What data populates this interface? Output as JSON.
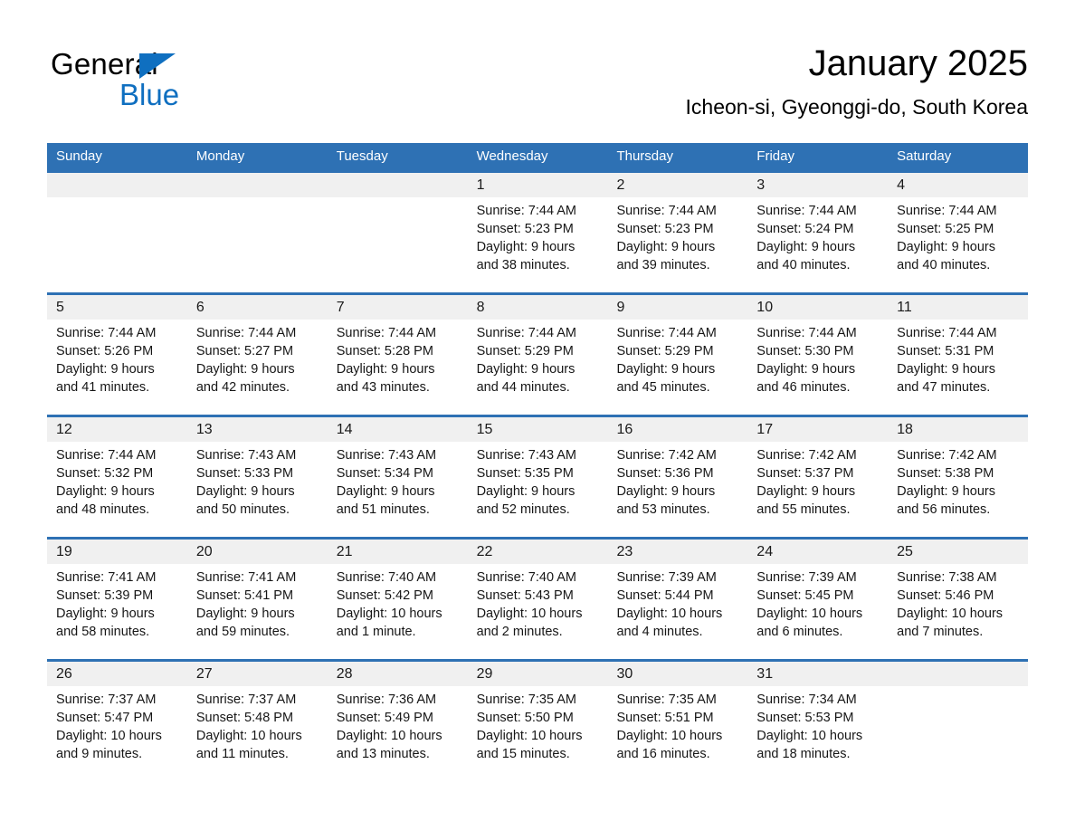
{
  "brand": {
    "name_part1": "General",
    "name_part2": "Blue",
    "triangle_icon": "triangle-icon",
    "accent_color": "#0F6FC0"
  },
  "header": {
    "title": "January 2025",
    "subtitle": "Icheon-si, Gyeonggi-do, South Korea"
  },
  "theme": {
    "header_blue": "#2E71B4",
    "daynum_band_gray": "#F0F0F0",
    "text_black": "#000000"
  },
  "weekdays": [
    "Sunday",
    "Monday",
    "Tuesday",
    "Wednesday",
    "Thursday",
    "Friday",
    "Saturday"
  ],
  "weeks": [
    [
      {
        "day": "",
        "sunrise": "",
        "sunset": "",
        "daylight1": "",
        "daylight2": ""
      },
      {
        "day": "",
        "sunrise": "",
        "sunset": "",
        "daylight1": "",
        "daylight2": ""
      },
      {
        "day": "",
        "sunrise": "",
        "sunset": "",
        "daylight1": "",
        "daylight2": ""
      },
      {
        "day": "1",
        "sunrise": "Sunrise: 7:44 AM",
        "sunset": "Sunset: 5:23 PM",
        "daylight1": "Daylight: 9 hours",
        "daylight2": "and 38 minutes."
      },
      {
        "day": "2",
        "sunrise": "Sunrise: 7:44 AM",
        "sunset": "Sunset: 5:23 PM",
        "daylight1": "Daylight: 9 hours",
        "daylight2": "and 39 minutes."
      },
      {
        "day": "3",
        "sunrise": "Sunrise: 7:44 AM",
        "sunset": "Sunset: 5:24 PM",
        "daylight1": "Daylight: 9 hours",
        "daylight2": "and 40 minutes."
      },
      {
        "day": "4",
        "sunrise": "Sunrise: 7:44 AM",
        "sunset": "Sunset: 5:25 PM",
        "daylight1": "Daylight: 9 hours",
        "daylight2": "and 40 minutes."
      }
    ],
    [
      {
        "day": "5",
        "sunrise": "Sunrise: 7:44 AM",
        "sunset": "Sunset: 5:26 PM",
        "daylight1": "Daylight: 9 hours",
        "daylight2": "and 41 minutes."
      },
      {
        "day": "6",
        "sunrise": "Sunrise: 7:44 AM",
        "sunset": "Sunset: 5:27 PM",
        "daylight1": "Daylight: 9 hours",
        "daylight2": "and 42 minutes."
      },
      {
        "day": "7",
        "sunrise": "Sunrise: 7:44 AM",
        "sunset": "Sunset: 5:28 PM",
        "daylight1": "Daylight: 9 hours",
        "daylight2": "and 43 minutes."
      },
      {
        "day": "8",
        "sunrise": "Sunrise: 7:44 AM",
        "sunset": "Sunset: 5:29 PM",
        "daylight1": "Daylight: 9 hours",
        "daylight2": "and 44 minutes."
      },
      {
        "day": "9",
        "sunrise": "Sunrise: 7:44 AM",
        "sunset": "Sunset: 5:29 PM",
        "daylight1": "Daylight: 9 hours",
        "daylight2": "and 45 minutes."
      },
      {
        "day": "10",
        "sunrise": "Sunrise: 7:44 AM",
        "sunset": "Sunset: 5:30 PM",
        "daylight1": "Daylight: 9 hours",
        "daylight2": "and 46 minutes."
      },
      {
        "day": "11",
        "sunrise": "Sunrise: 7:44 AM",
        "sunset": "Sunset: 5:31 PM",
        "daylight1": "Daylight: 9 hours",
        "daylight2": "and 47 minutes."
      }
    ],
    [
      {
        "day": "12",
        "sunrise": "Sunrise: 7:44 AM",
        "sunset": "Sunset: 5:32 PM",
        "daylight1": "Daylight: 9 hours",
        "daylight2": "and 48 minutes."
      },
      {
        "day": "13",
        "sunrise": "Sunrise: 7:43 AM",
        "sunset": "Sunset: 5:33 PM",
        "daylight1": "Daylight: 9 hours",
        "daylight2": "and 50 minutes."
      },
      {
        "day": "14",
        "sunrise": "Sunrise: 7:43 AM",
        "sunset": "Sunset: 5:34 PM",
        "daylight1": "Daylight: 9 hours",
        "daylight2": "and 51 minutes."
      },
      {
        "day": "15",
        "sunrise": "Sunrise: 7:43 AM",
        "sunset": "Sunset: 5:35 PM",
        "daylight1": "Daylight: 9 hours",
        "daylight2": "and 52 minutes."
      },
      {
        "day": "16",
        "sunrise": "Sunrise: 7:42 AM",
        "sunset": "Sunset: 5:36 PM",
        "daylight1": "Daylight: 9 hours",
        "daylight2": "and 53 minutes."
      },
      {
        "day": "17",
        "sunrise": "Sunrise: 7:42 AM",
        "sunset": "Sunset: 5:37 PM",
        "daylight1": "Daylight: 9 hours",
        "daylight2": "and 55 minutes."
      },
      {
        "day": "18",
        "sunrise": "Sunrise: 7:42 AM",
        "sunset": "Sunset: 5:38 PM",
        "daylight1": "Daylight: 9 hours",
        "daylight2": "and 56 minutes."
      }
    ],
    [
      {
        "day": "19",
        "sunrise": "Sunrise: 7:41 AM",
        "sunset": "Sunset: 5:39 PM",
        "daylight1": "Daylight: 9 hours",
        "daylight2": "and 58 minutes."
      },
      {
        "day": "20",
        "sunrise": "Sunrise: 7:41 AM",
        "sunset": "Sunset: 5:41 PM",
        "daylight1": "Daylight: 9 hours",
        "daylight2": "and 59 minutes."
      },
      {
        "day": "21",
        "sunrise": "Sunrise: 7:40 AM",
        "sunset": "Sunset: 5:42 PM",
        "daylight1": "Daylight: 10 hours",
        "daylight2": "and 1 minute."
      },
      {
        "day": "22",
        "sunrise": "Sunrise: 7:40 AM",
        "sunset": "Sunset: 5:43 PM",
        "daylight1": "Daylight: 10 hours",
        "daylight2": "and 2 minutes."
      },
      {
        "day": "23",
        "sunrise": "Sunrise: 7:39 AM",
        "sunset": "Sunset: 5:44 PM",
        "daylight1": "Daylight: 10 hours",
        "daylight2": "and 4 minutes."
      },
      {
        "day": "24",
        "sunrise": "Sunrise: 7:39 AM",
        "sunset": "Sunset: 5:45 PM",
        "daylight1": "Daylight: 10 hours",
        "daylight2": "and 6 minutes."
      },
      {
        "day": "25",
        "sunrise": "Sunrise: 7:38 AM",
        "sunset": "Sunset: 5:46 PM",
        "daylight1": "Daylight: 10 hours",
        "daylight2": "and 7 minutes."
      }
    ],
    [
      {
        "day": "26",
        "sunrise": "Sunrise: 7:37 AM",
        "sunset": "Sunset: 5:47 PM",
        "daylight1": "Daylight: 10 hours",
        "daylight2": "and 9 minutes."
      },
      {
        "day": "27",
        "sunrise": "Sunrise: 7:37 AM",
        "sunset": "Sunset: 5:48 PM",
        "daylight1": "Daylight: 10 hours",
        "daylight2": "and 11 minutes."
      },
      {
        "day": "28",
        "sunrise": "Sunrise: 7:36 AM",
        "sunset": "Sunset: 5:49 PM",
        "daylight1": "Daylight: 10 hours",
        "daylight2": "and 13 minutes."
      },
      {
        "day": "29",
        "sunrise": "Sunrise: 7:35 AM",
        "sunset": "Sunset: 5:50 PM",
        "daylight1": "Daylight: 10 hours",
        "daylight2": "and 15 minutes."
      },
      {
        "day": "30",
        "sunrise": "Sunrise: 7:35 AM",
        "sunset": "Sunset: 5:51 PM",
        "daylight1": "Daylight: 10 hours",
        "daylight2": "and 16 minutes."
      },
      {
        "day": "31",
        "sunrise": "Sunrise: 7:34 AM",
        "sunset": "Sunset: 5:53 PM",
        "daylight1": "Daylight: 10 hours",
        "daylight2": "and 18 minutes."
      },
      {
        "day": "",
        "sunrise": "",
        "sunset": "",
        "daylight1": "",
        "daylight2": ""
      }
    ]
  ]
}
